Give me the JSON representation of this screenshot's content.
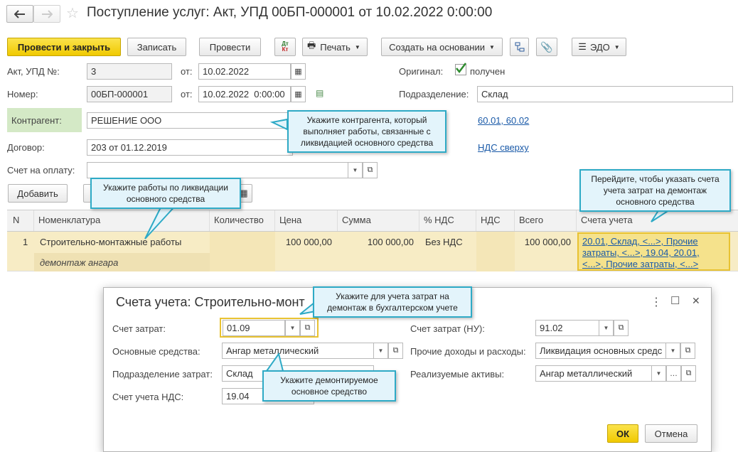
{
  "window": {
    "title": "Поступление услуг: Акт, УПД 00БП-000001 от 10.02.2022 0:00:00",
    "back_icon": "arrow-left",
    "forward_icon": "arrow-right",
    "star_icon": "star"
  },
  "toolbar": {
    "post_close": "Провести и закрыть",
    "save": "Записать",
    "post": "Провести",
    "dtkt_top": "Дт",
    "dtkt_bottom": "Кт",
    "print": "Печать",
    "create_based": "Создать на основании",
    "edo": "ЭДО"
  },
  "form": {
    "act_label": "Акт, УПД №:",
    "act_value": "3",
    "from_label": "от:",
    "act_date": "10.02.2022",
    "number_label": "Номер:",
    "number_value": "00БП-000001",
    "from_label2": "от:",
    "number_date": "10.02.2022  0:00:00",
    "original_label": "Оригинал:",
    "original_checked_text": "получен",
    "division_label": "Подразделение:",
    "division_value": "Склад",
    "counterparty_label": "Контрагент:",
    "counterparty_value": "РЕШЕНИЕ ООО",
    "accounts_link": "60.01, 60.02",
    "contract_label": "Договор:",
    "contract_value": "203 от 01.12.2019",
    "vat_link": "НДС сверху",
    "invoice_label": "Счет на оплату:",
    "invoice_value": "",
    "add_button": "Добавить",
    "hidden_button": "П"
  },
  "table": {
    "headers": [
      "N",
      "Номенклатура",
      "Количество",
      "Цена",
      "Сумма",
      "% НДС",
      "НДС",
      "Всего",
      "Счета учета"
    ],
    "row": {
      "n": "1",
      "nomenclature": "Строительно-монтажные работы",
      "content": "демонтаж ангара",
      "quantity": "",
      "price": "100 000,00",
      "sum": "100 000,00",
      "vat_rate": "Без НДС",
      "vat": "",
      "total": "100 000,00",
      "accounts_line1": "20.01, Склад, <...>, Прочие",
      "accounts_line2": "затраты, <...>, 19.04, 20.01,",
      "accounts_line3": "<...>, Прочие затраты, <...>"
    }
  },
  "dialog": {
    "title": "Счета учета: Строительно-монт",
    "cost_account_label": "Счет затрат:",
    "cost_account_value": "01.09",
    "fixed_assets_label": "Основные средства:",
    "fixed_assets_value": "Ангар металлический",
    "cost_division_label": "Подразделение затрат:",
    "cost_division_value": "Склад",
    "vat_account_label": "Счет учета НДС:",
    "vat_account_value": "19.04",
    "tax_cost_label": "Счет затрат (НУ):",
    "tax_cost_value": "91.02",
    "other_label": "Прочие доходы и расходы:",
    "other_value": "Ликвидация основных средс",
    "assets_label": "Реализуемые активы:",
    "assets_value": "Ангар металлический",
    "ok": "ОК",
    "cancel": "Отмена",
    "more_icon": "⋮",
    "maximize_icon": "☐",
    "close_icon": "✕"
  },
  "callouts": {
    "counterparty": "Укажите контрагента, который выполняет работы, связанные с ликвидацией основного средства",
    "works": "Укажите работы по ликвидации основного средства",
    "accounts": "Перейдите, чтобы указать счета учета затрат на демонтаж основного средства",
    "cost": "Укажите для учета затрат на демонтаж в бухгалтерском учете",
    "asset": "Укажите демонтируемое основное средство"
  }
}
